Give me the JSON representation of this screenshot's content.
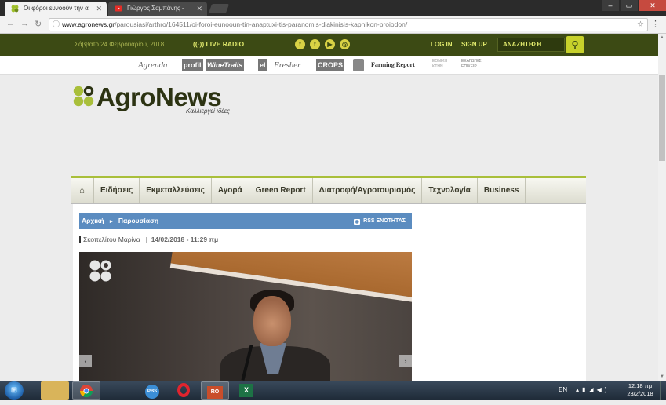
{
  "browser": {
    "tabs": [
      {
        "title": "Οι φόροι ευνοούν την α",
        "active": true
      },
      {
        "title": "Γιώργος Σαμπάνης -",
        "active": false
      }
    ],
    "url_prefix": "www.agronews.gr",
    "url_path": "/parousiasi/arthro/164511/oi-foroi-eunooun-tin-anaptuxi-tis-paranomis-diakinisis-kapnikon-proiodon/"
  },
  "topbar": {
    "date": "Σάββατο 24 Φεβρουαρίου, 2018",
    "radio": "LIVE RADIO",
    "social": [
      "f",
      "t",
      "▶",
      "◎"
    ],
    "login": "LOG IN",
    "signup": "SIGN UP",
    "search_placeholder": "ΑΝΑΖΗΤΗΣΗ"
  },
  "partners": [
    "Agrenda",
    "profil",
    "WineTrails",
    "el",
    "Fresher",
    "CROPS",
    "Farming Report",
    "ΕΘΝΙΚΗ ΚΤΗΝ.",
    "ΕΞΑΓΩΓΕΣ ΕΠΙΧΕΙΡ."
  ],
  "logo": {
    "name": "AgroNews",
    "tagline": "Καλλιεργεί ιδέες"
  },
  "menu": [
    "Ειδήσεις",
    "Εκμεταλλεύσεις",
    "Αγορά",
    "Green Report",
    "Διατροφή/Αγροτουρισμός",
    "Τεχνολογία",
    "Business"
  ],
  "article": {
    "breadcrumb_home": "Αρχική",
    "breadcrumb_section": "Παρουσίαση",
    "rss": "RSS ΕΝΟΤΗΤΑΣ",
    "author": "Σκοπελίτου Μαρίνα",
    "date": "14/02/2018 - 11:29 πμ"
  },
  "taskbar": {
    "apps": [
      "",
      "",
      "",
      "PBS",
      "",
      "RO",
      "X"
    ],
    "lang": "EN",
    "time": "12:18 πμ",
    "date": "23/2/2018"
  },
  "colors": {
    "brand_green": "#3c4a14",
    "accent_lime": "#c7d12b",
    "crumb_blue": "#5b8cc0"
  }
}
